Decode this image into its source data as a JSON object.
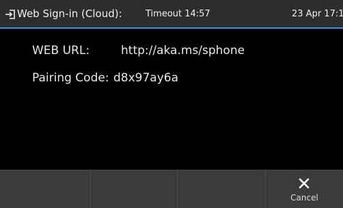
{
  "status": {
    "icon": "sign-in-icon",
    "title": "Web Sign-in (Cloud):",
    "timeout": "Timeout 14:57",
    "date": "23 Apr 17:1"
  },
  "content": {
    "web_url_label": "WEB URL:",
    "web_url_value": "http://aka.ms/sphone",
    "pairing_label": "Pairing Code:",
    "pairing_value": "d8x97ay6a"
  },
  "softkeys": {
    "cancel_label": "Cancel",
    "cancel_icon": "close-icon"
  },
  "colors": {
    "accent": "#3a8fd6",
    "statusbar": "#2d2d2d",
    "softkey_bar": "#3b3b3b",
    "background": "#000000"
  }
}
